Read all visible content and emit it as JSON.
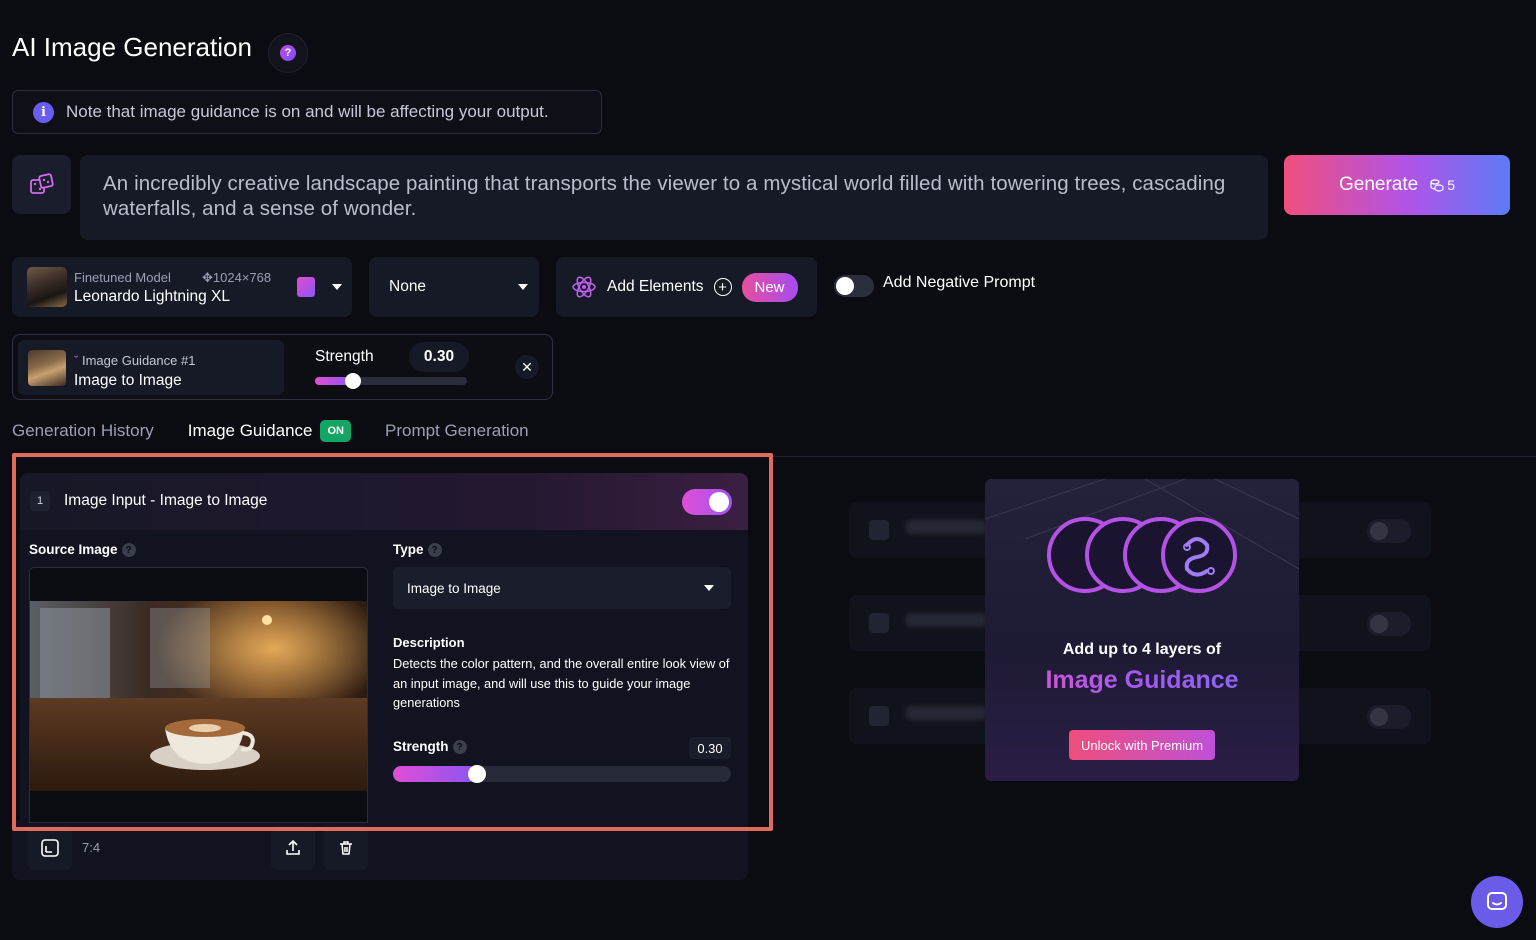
{
  "header": {
    "title": "AI Image Generation",
    "help_icon": "question-icon"
  },
  "note": {
    "text": "Note that image guidance is on and will be affecting your output.",
    "icon": "info-icon"
  },
  "prompt": {
    "text": "An incredibly creative landscape painting that transports the viewer to a mystical world filled with towering trees, cascading waterfalls, and a sense of wonder.",
    "dice_icon": "dice-icon"
  },
  "generate": {
    "label": "Generate",
    "cost": "5",
    "icon": "token-stack-icon"
  },
  "model": {
    "subtitle": "Finetuned Model",
    "resolution": "1024×768",
    "name": "Leonardo Lightning XL",
    "resolution_icon": "move-icon"
  },
  "style_select": {
    "value": "None"
  },
  "elements": {
    "label": "Add Elements",
    "badge": "New",
    "icon": "atom-icon"
  },
  "negative_prompt": {
    "label": "Add Negative Prompt",
    "enabled": false
  },
  "guidance_chip": {
    "title": "Image Guidance #1",
    "type": "Image to Image",
    "strength_label": "Strength",
    "strength_value": "0.30",
    "strength": 0.3
  },
  "tabs": [
    {
      "label": "Generation History"
    },
    {
      "label": "Image Guidance",
      "badge": "ON"
    },
    {
      "label": "Prompt Generation"
    }
  ],
  "card": {
    "number": "1",
    "title": "Image Input - Image to Image",
    "enabled": true,
    "source_label": "Source Image",
    "type_label": "Type",
    "type_value": "Image to Image",
    "description_label": "Description",
    "description": "Detects the color pattern, and the overall entire look view of an input image, and will use this to guide your image generations",
    "strength_label": "Strength",
    "strength_value": "0.30",
    "strength": 0.3,
    "aspect": "7:4"
  },
  "promo": {
    "line1": "Add up to 4 layers of",
    "line2": "Image Guidance",
    "button": "Unlock with Premium"
  },
  "colors": {
    "accent": "#a054ef",
    "pink": "#e04fd6",
    "highlight": "#e06a5b",
    "on_badge": "#14a564"
  }
}
